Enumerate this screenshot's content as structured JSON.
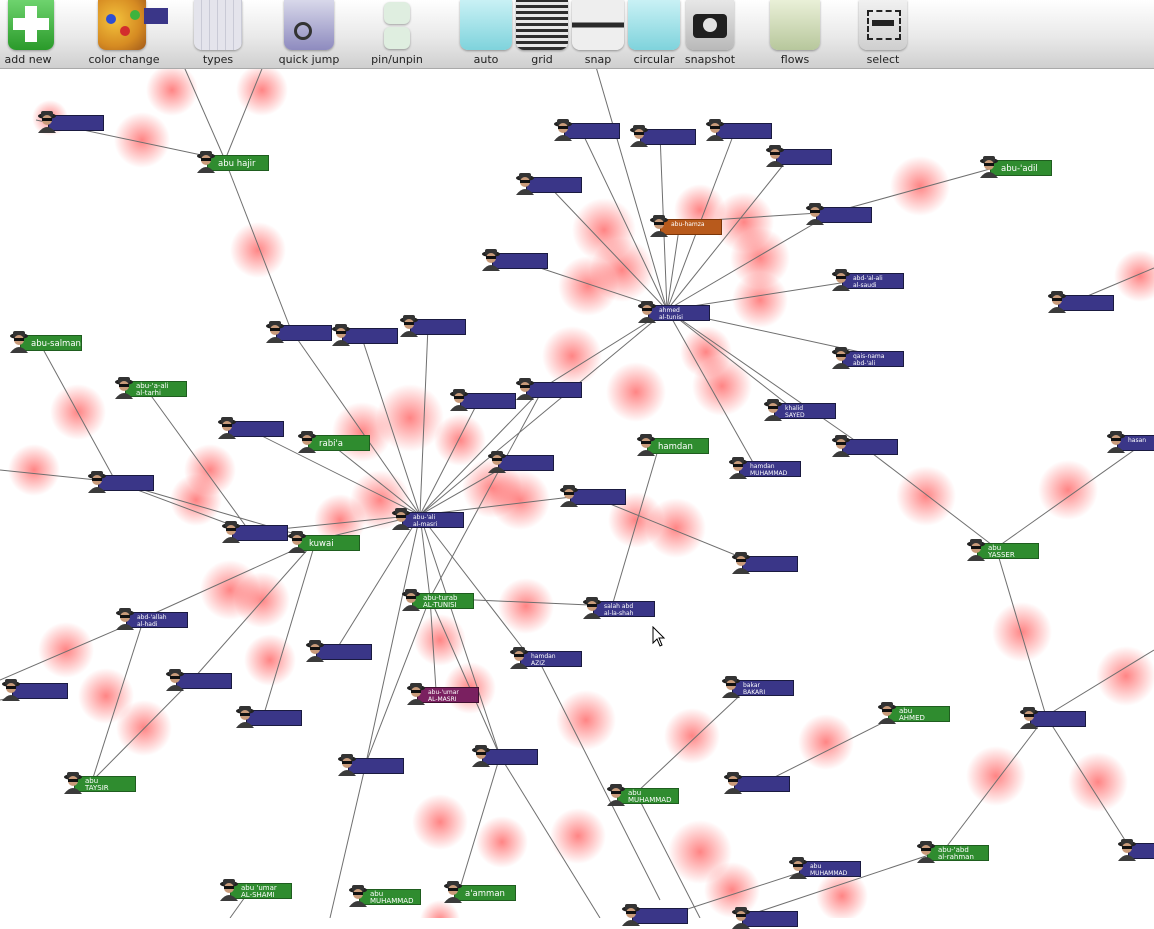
{
  "toolbar": {
    "items": [
      {
        "id": "add-new",
        "label": "add new",
        "icon": "plus-icon"
      },
      {
        "id": "color-change",
        "label": "color change",
        "icon": "palette-icon"
      },
      {
        "id": "types",
        "label": "types",
        "icon": "types-icon"
      },
      {
        "id": "quick-jump",
        "label": "quick jump",
        "icon": "quick-jump-icon"
      },
      {
        "id": "pin-unpin",
        "label": "pin/unpin",
        "icon": "pin-icon"
      },
      {
        "id": "auto",
        "label": "auto",
        "icon": "auto-layout-icon"
      },
      {
        "id": "grid",
        "label": "grid",
        "icon": "grid-layout-icon"
      },
      {
        "id": "snap",
        "label": "snap",
        "icon": "snap-icon"
      },
      {
        "id": "circular",
        "label": "circular",
        "icon": "circular-layout-icon"
      },
      {
        "id": "snapshot",
        "label": "snapshot",
        "icon": "camera-icon"
      },
      {
        "id": "flows",
        "label": "flows",
        "icon": "money-icon"
      },
      {
        "id": "select",
        "label": "select",
        "icon": "selection-icon"
      }
    ]
  },
  "colors": {
    "blue_node": "#3a3688",
    "green_node": "#2f8c2f",
    "orange_node": "#b85a1c",
    "purple_node": "#7a2060",
    "heat": "#ff2020",
    "edge": "#6f6f6f"
  },
  "nodes": [
    {
      "id": "n1",
      "label": "abu hajir",
      "color": "green"
    },
    {
      "id": "n2",
      "label": "abu-'adil",
      "color": "green"
    },
    {
      "id": "n3",
      "label": "rabi'a",
      "color": "green"
    },
    {
      "id": "n4",
      "label": "hamdan",
      "color": "green"
    },
    {
      "id": "n5",
      "label": "kuwai",
      "color": "green"
    },
    {
      "id": "n6",
      "label": "abu-turab\nAL-TUNISI",
      "color": "green"
    },
    {
      "id": "n7",
      "label": "abu\nYASSER",
      "color": "green"
    },
    {
      "id": "n8",
      "label": "abu\nTAYSIR",
      "color": "green"
    },
    {
      "id": "n9",
      "label": "abu-'a-ali\nal-tarhi",
      "color": "green"
    },
    {
      "id": "n10",
      "label": "abu\nAHMED",
      "color": "green"
    },
    {
      "id": "n11",
      "label": "abu-salman",
      "color": "green"
    },
    {
      "id": "n12",
      "label": "abu-'abd\nal-rahman",
      "color": "green"
    },
    {
      "id": "n13",
      "label": "abu\nMUHAMMAD",
      "color": "green"
    },
    {
      "id": "n14",
      "label": "a'amman",
      "color": "green"
    },
    {
      "id": "n15",
      "label": "abu 'umar\nAL-SHAMI",
      "color": "green"
    },
    {
      "id": "n16",
      "label": "abu\nMUHAMMAD\nAL-MASRI",
      "color": "green"
    },
    {
      "id": "n17",
      "label": "abu-hamza",
      "color": "orange"
    },
    {
      "id": "n18",
      "label": "abu-'umar\nAL-MASRI",
      "color": "purple"
    },
    {
      "id": "n19",
      "label": "hamdan\nAZIZ",
      "color": "blue"
    },
    {
      "id": "n20",
      "label": "bakar\nBAKARI",
      "color": "blue"
    },
    {
      "id": "n21",
      "label": "salah abd\nal-la-shah",
      "color": "blue"
    },
    {
      "id": "n22",
      "label": "hamdan\nMUHAMMAD\nSALIM",
      "color": "blue"
    },
    {
      "id": "n23",
      "label": "khalid\nSAYED\nRASHID",
      "color": "blue"
    },
    {
      "id": "n24",
      "label": "abu\nMUHAMMAD\nAL-MASRI",
      "color": "blue"
    },
    {
      "id": "n25",
      "label": "qais-nama\nabd-'ali",
      "color": "blue"
    },
    {
      "id": "n26",
      "label": "abd-'allah\nal-hadi",
      "color": "blue"
    },
    {
      "id": "n27",
      "label": "hasan",
      "color": "blue"
    },
    {
      "id": "n28",
      "label": "abd-'al-ali\nal-saudi",
      "color": "blue"
    },
    {
      "id": "n29",
      "label": "ahmed\nal-tunisi",
      "color": "blue"
    },
    {
      "id": "n30",
      "label": "abu-'ali\nal-masri",
      "color": "blue"
    }
  ]
}
